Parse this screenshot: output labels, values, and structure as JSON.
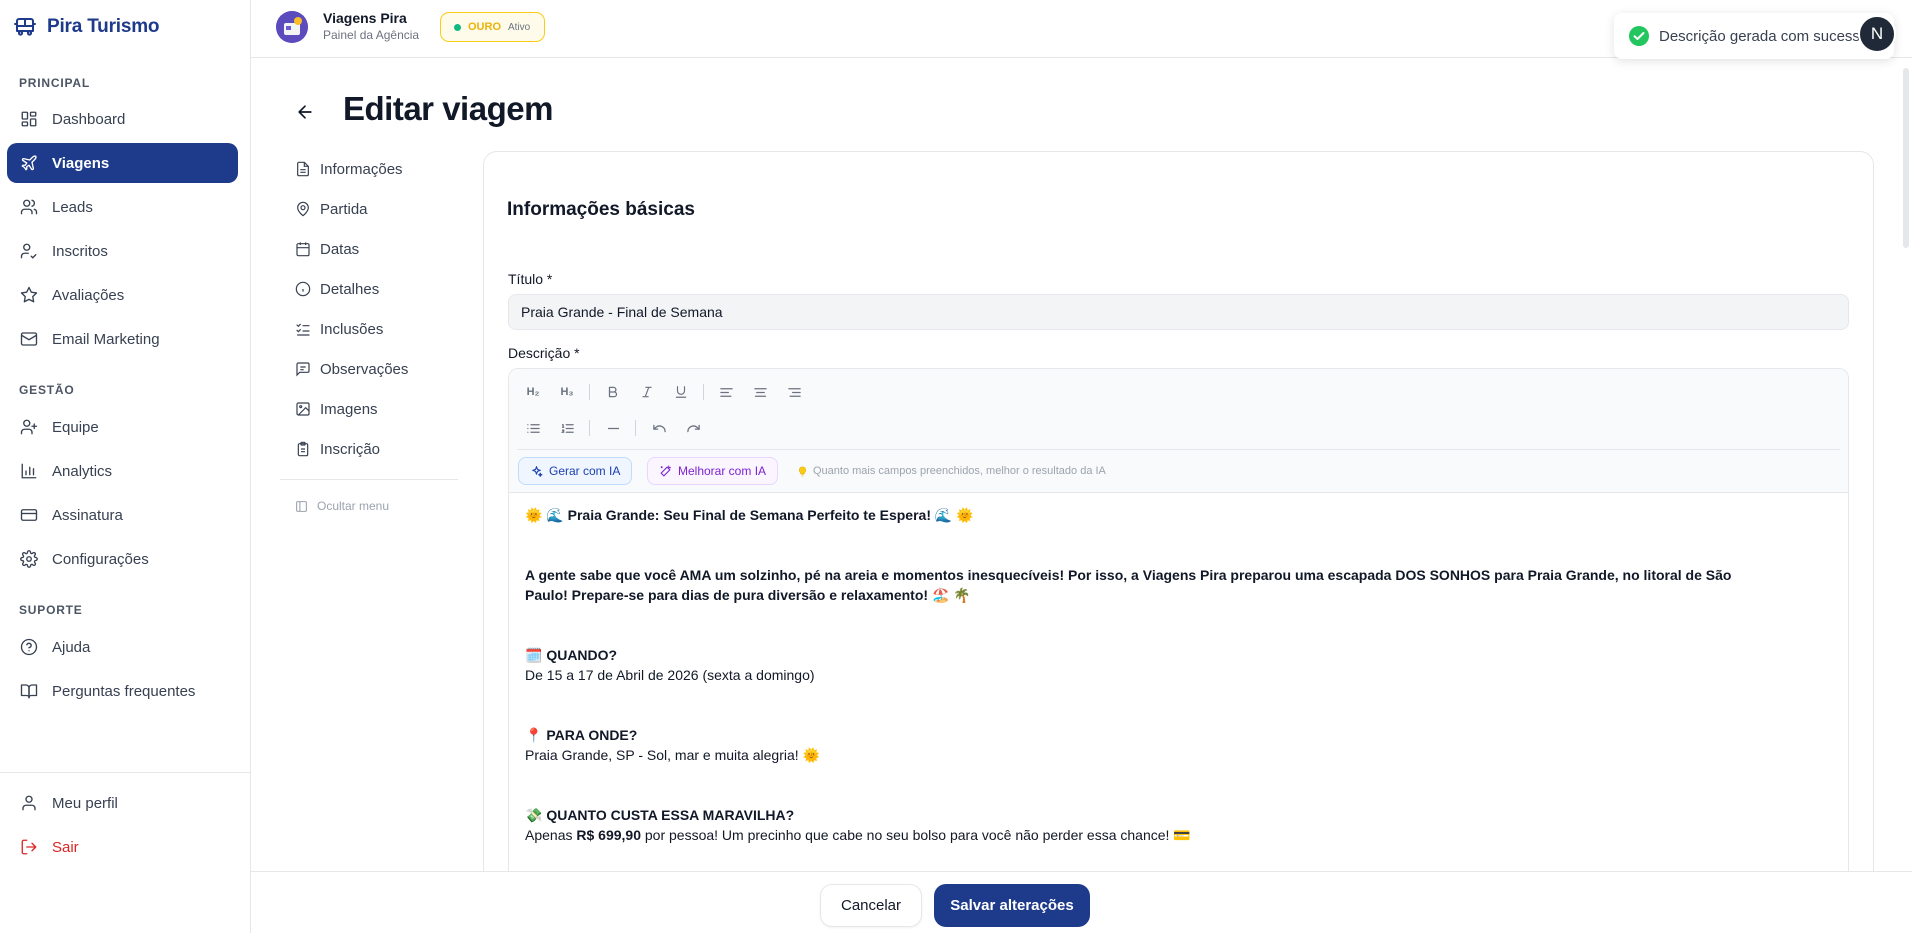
{
  "brand": {
    "name": "Pira Turismo"
  },
  "sidebar": {
    "sections": {
      "principal": "PRINCIPAL",
      "gestao": "GESTÃO",
      "suporte": "SUPORTE"
    },
    "items": [
      {
        "label": "Dashboard",
        "icon": "dashboard-icon"
      },
      {
        "label": "Viagens",
        "icon": "plane-icon",
        "active": true
      },
      {
        "label": "Leads",
        "icon": "users-icon"
      },
      {
        "label": "Inscritos",
        "icon": "user-check-icon"
      },
      {
        "label": "Avaliações",
        "icon": "star-icon"
      },
      {
        "label": "Email Marketing",
        "icon": "mail-icon"
      },
      {
        "label": "Equipe",
        "icon": "user-plus-icon"
      },
      {
        "label": "Analytics",
        "icon": "bar-chart-icon"
      },
      {
        "label": "Assinatura",
        "icon": "credit-card-icon"
      },
      {
        "label": "Configurações",
        "icon": "gear-icon"
      },
      {
        "label": "Ajuda",
        "icon": "help-circle-icon"
      },
      {
        "label": "Perguntas frequentes",
        "icon": "book-icon"
      }
    ],
    "bottom": [
      {
        "label": "Meu perfil",
        "icon": "user-icon"
      },
      {
        "label": "Sair",
        "icon": "logout-icon"
      }
    ]
  },
  "header": {
    "agency_name": "Viagens Pira",
    "agency_sub": "Painel da Agência",
    "tier_name": "OURO",
    "tier_status": "Ativo",
    "user_initial": "N"
  },
  "toast": {
    "message": "Descrição gerada com sucesso!"
  },
  "page": {
    "title": "Editar viagem"
  },
  "section_nav": {
    "items": [
      {
        "label": "Informações",
        "icon": "file-icon"
      },
      {
        "label": "Partida",
        "icon": "map-pin-icon"
      },
      {
        "label": "Datas",
        "icon": "calendar-icon"
      },
      {
        "label": "Detalhes",
        "icon": "info-icon"
      },
      {
        "label": "Inclusões",
        "icon": "checklist-icon"
      },
      {
        "label": "Observações",
        "icon": "message-icon"
      },
      {
        "label": "Imagens",
        "icon": "image-icon"
      },
      {
        "label": "Inscrição",
        "icon": "clipboard-icon"
      }
    ],
    "hide_menu": "Ocultar menu"
  },
  "form": {
    "section_title": "Informações básicas",
    "title_label": "Título *",
    "title_value": "Praia Grande - Final de Semana",
    "description_label": "Descrição *"
  },
  "editor": {
    "toolbar": {
      "h2": "H₂",
      "h3": "H₃"
    },
    "ai_generate": "Gerar com IA",
    "ai_improve": "Melhorar com IA",
    "ai_hint": "Quanto mais campos preenchidos, melhor o resultado da IA",
    "content": {
      "heading": "🌞 🌊 Praia Grande: Seu Final de Semana Perfeito te Espera! 🌊 🌞",
      "intro_line1": "A gente sabe que você AMA um solzinho, pé na areia e momentos inesquecíveis! Por isso, a Viagens Pira preparou uma escapada DOS SONHOS para Praia Grande, no litoral de São",
      "intro_line2": "Paulo! Prepare-se para dias de pura diversão e relaxamento! 🏖️ 🌴",
      "when_title": "🗓️ QUANDO?",
      "when_text": "De 15 a 17 de Abril de 2026 (sexta a domingo)",
      "where_title": "📍 PARA ONDE?",
      "where_text": "Praia Grande, SP - Sol, mar e muita alegria! 🌞",
      "price_title": "💸 QUANTO CUSTA ESSA MARAVILHA?",
      "price_pre": "Apenas ",
      "price_value": "R$ 699,90",
      "price_post": " por pessoa! Um precinho que cabe no seu bolso para você não perder essa chance! 💳"
    }
  },
  "footer": {
    "cancel": "Cancelar",
    "save": "Salvar alterações"
  },
  "colors": {
    "primary": "#1e3a8a",
    "accent_gold": "#facc15",
    "danger": "#dc2626",
    "success": "#22c55e"
  }
}
